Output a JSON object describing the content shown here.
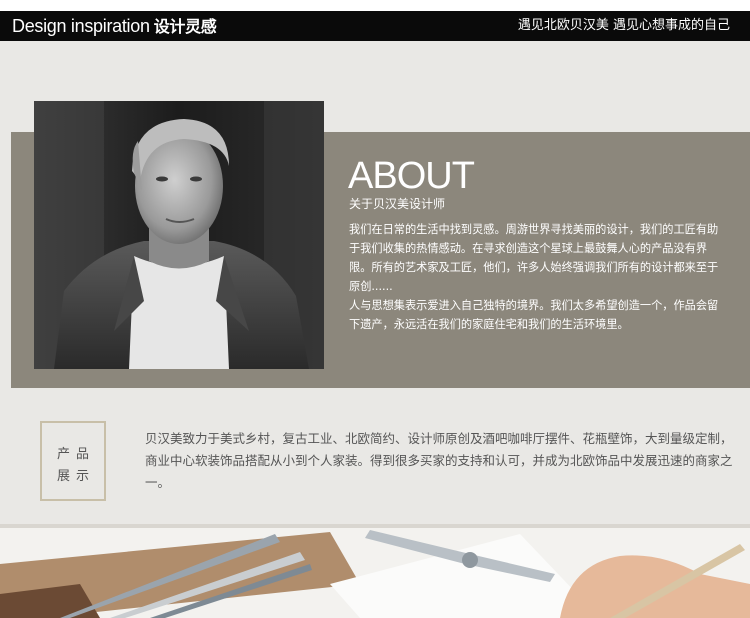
{
  "header": {
    "title_en": "Design inspiration",
    "title_cn": "设计灵感",
    "slogan": "遇见北欧贝汉美 遇见心想事成的自己"
  },
  "about": {
    "heading": "ABOUT",
    "subtitle": "关于贝汉美设计师",
    "paragraph1": "我们在日常的生活中找到灵感。周游世界寻找美丽的设计，我们的工匠有助于我们收集的热情感动。在寻求创造这个星球上最鼓舞人心的产品没有界限。所有的艺术家及工匠，他们，许多人始终强调我们所有的设计都来至于原创......",
    "paragraph2": "人与思想集表示爱进入自己独特的境界。我们太多希望创造一个，作品会留下遗产，永远活在我们的家庭住宅和我们的生活环境里。"
  },
  "products": {
    "label_line1": "产品",
    "label_line2": "展示",
    "description": "贝汉美致力于美式乡村，复古工业、北欧简约、设计师原创及酒吧咖啡厅摆件、花瓶壁饰，大到量级定制，商业中心软装饰品搭配从小到个人家装。得到很多买家的支持和认可，并成为北欧饰品中发展迅速的商家之一。"
  },
  "colors": {
    "header_bg": "#0a0a0a",
    "panel_bg": "#e9e8e5",
    "band_bg": "#8c877c",
    "box_border": "#c8bfa8",
    "body_text": "#555555"
  }
}
